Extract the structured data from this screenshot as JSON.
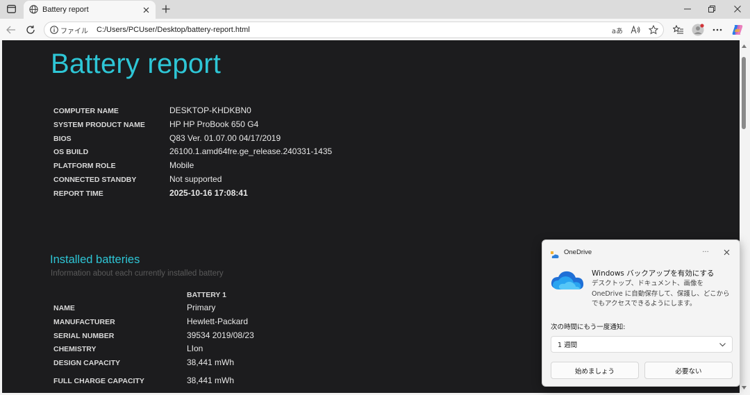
{
  "browser": {
    "tab_title": "Battery report",
    "address_label": "ファイル",
    "url": "C:/Users/PCUser/Desktop/battery-report.html",
    "read_aloud_label": "aあ"
  },
  "report": {
    "title": "Battery report",
    "system_info": [
      {
        "label": "COMPUTER NAME",
        "value": "DESKTOP-KHDKBN0"
      },
      {
        "label": "SYSTEM PRODUCT NAME",
        "value": "HP HP ProBook 650 G4"
      },
      {
        "label": "BIOS",
        "value": "Q83 Ver. 01.07.00 04/17/2019"
      },
      {
        "label": "OS BUILD",
        "value": "26100.1.amd64fre.ge_release.240331-1435"
      },
      {
        "label": "PLATFORM ROLE",
        "value": "Mobile"
      },
      {
        "label": "CONNECTED STANDBY",
        "value": "Not supported"
      },
      {
        "label": "REPORT TIME",
        "value": "2025-10-16  17:08:41"
      }
    ],
    "installed": {
      "title": "Installed batteries",
      "subtitle": "Information about each currently installed battery",
      "column": "BATTERY 1",
      "rows": [
        {
          "label": "NAME",
          "value": "Primary"
        },
        {
          "label": "MANUFACTURER",
          "value": "Hewlett-Packard"
        },
        {
          "label": "SERIAL NUMBER",
          "value": "39534 2019/08/23"
        },
        {
          "label": "CHEMISTRY",
          "value": "LIon"
        },
        {
          "label": "DESIGN CAPACITY",
          "value": "38,441 mWh"
        },
        {
          "label": "FULL CHARGE CAPACITY",
          "value": "38,441 mWh"
        }
      ]
    }
  },
  "notification": {
    "app_name": "OneDrive",
    "more_label": "···",
    "heading": "Windows バックアップを有効にする",
    "body": "デスクトップ、ドキュメント、画像を OneDrive に自動保存して、保護し、どこからでもアクセスできるようにします。",
    "prompt": "次の時間にもう一度通知:",
    "select_value": "1 週間",
    "primary_button": "始めましょう",
    "secondary_button": "必要ない"
  },
  "colors": {
    "accent": "#2ec6d6",
    "content_bg": "#1c1c1e"
  }
}
